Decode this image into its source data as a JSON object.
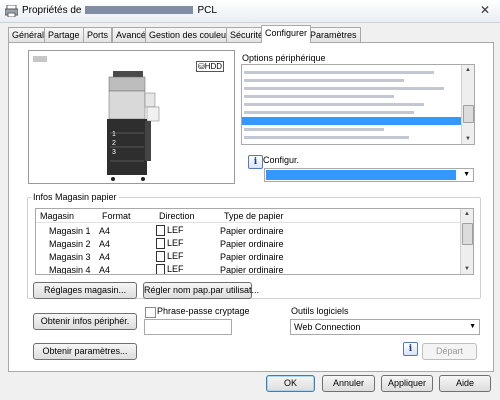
{
  "window": {
    "title_prefix": "Propriétés de",
    "title_suffix": "PCL",
    "close_glyph": "✕"
  },
  "tabs": [
    {
      "label": "Général"
    },
    {
      "label": "Partage"
    },
    {
      "label": "Ports"
    },
    {
      "label": "Avancé"
    },
    {
      "label": "Gestion des couleurs"
    },
    {
      "label": "Sécurité"
    },
    {
      "label": "Configurer",
      "active": true
    },
    {
      "label": "Paramètres"
    }
  ],
  "preview": {
    "hdd_label": "HDD",
    "tray_numbers": [
      "1",
      "2",
      "3"
    ]
  },
  "options": {
    "label": "Options périphérique"
  },
  "configur": {
    "label": "Configur.",
    "info_glyph": "i"
  },
  "paper": {
    "group_title": "Infos Magasin papier",
    "headers": [
      "Magasin",
      "Format",
      "Direction",
      "Type de papier"
    ],
    "rows": [
      {
        "magasin": "Magasin 1",
        "format": "A4",
        "direction": "LEF",
        "type": "Papier ordinaire"
      },
      {
        "magasin": "Magasin 2",
        "format": "A4",
        "direction": "LEF",
        "type": "Papier ordinaire"
      },
      {
        "magasin": "Magasin 3",
        "format": "A4",
        "direction": "LEF",
        "type": "Papier ordinaire"
      },
      {
        "magasin": "Magasin 4",
        "format": "A4",
        "direction": "LEF",
        "type": "Papier ordinaire"
      }
    ],
    "btn_reglages": "Réglages magasin...",
    "btn_regler_nom": "Régler nom pap.par utilisat..."
  },
  "lower": {
    "btn_obtenir_infos": "Obtenir infos périphér.",
    "phrase_label": "Phrase-passe cryptage",
    "outils_label": "Outils logiciels",
    "outils_value": "Web Connection",
    "btn_obtenir_params": "Obtenir paramètres...",
    "btn_depart": "Départ",
    "info_glyph": "i"
  },
  "footer": {
    "ok": "OK",
    "annuler": "Annuler",
    "appliquer": "Appliquer",
    "aide": "Aide"
  }
}
